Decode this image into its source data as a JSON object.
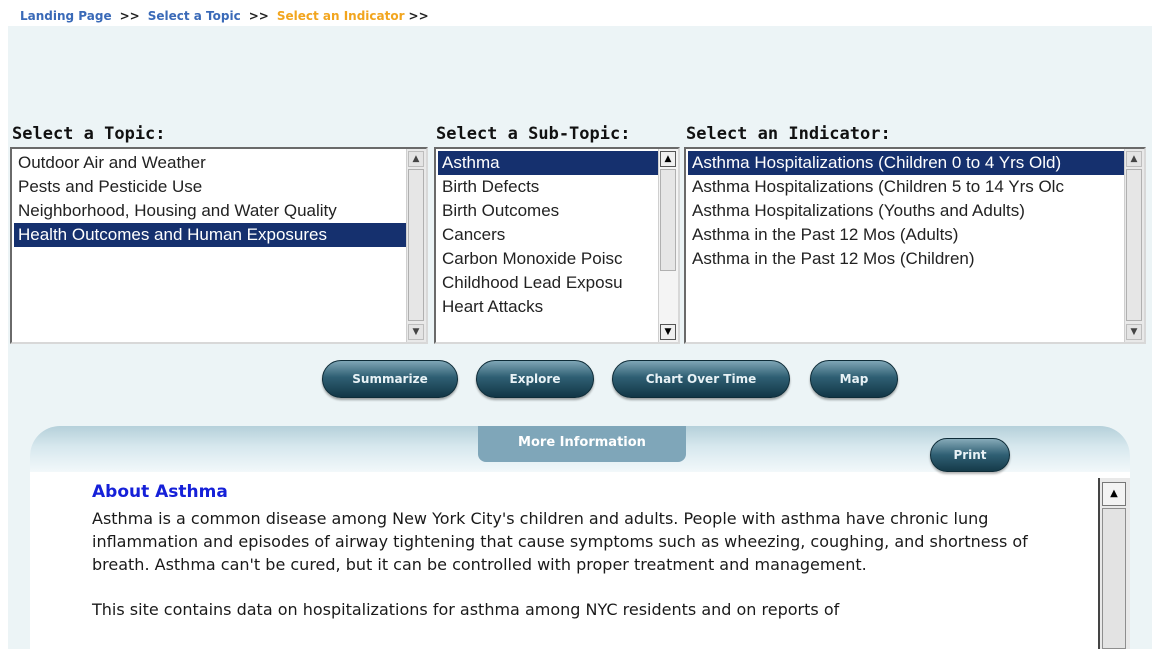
{
  "breadcrumb": {
    "items": [
      "Landing Page",
      "Select a Topic",
      "Select an Indicator"
    ],
    "separator": ">>"
  },
  "colors": {
    "breadcrumb_link": "#3a6ab8",
    "breadcrumb_current": "#f2a51e",
    "panel_background": "#ecf4f6",
    "selected_item": "#15306e",
    "button": "#2f5f73",
    "about_title": "#1520d8"
  },
  "topic": {
    "label": "Select a Topic:",
    "items": [
      "Outdoor Air and Weather",
      "Pests and Pesticide Use",
      "Neighborhood, Housing and Water Quality",
      "Health Outcomes and Human Exposures"
    ],
    "selected": "Health Outcomes and Human Exposures"
  },
  "subtopic": {
    "label": "Select a Sub-Topic:",
    "items": [
      "Asthma",
      "Birth Defects",
      "Birth Outcomes",
      "Cancers",
      "Carbon Monoxide Poisc",
      "Childhood Lead Exposu",
      "Heart Attacks"
    ],
    "selected": "Asthma"
  },
  "indicator": {
    "label": "Select an Indicator:",
    "items": [
      "Asthma Hospitalizations (Children 0 to 4 Yrs Old)",
      "Asthma Hospitalizations (Children 5 to 14 Yrs Olc",
      "Asthma Hospitalizations (Youths and Adults)",
      "Asthma in the Past 12 Mos (Adults)",
      "Asthma in the Past 12 Mos (Children)"
    ],
    "selected": "Asthma Hospitalizations (Children 0 to 4 Yrs Old)"
  },
  "actions": {
    "summarize": "Summarize",
    "explore": "Explore",
    "chart_over_time": "Chart Over Time",
    "map": "Map"
  },
  "more_info": {
    "tab_label": "More Information",
    "print_label": "Print",
    "about_title": "About Asthma",
    "paragraphs": [
      "Asthma is a common disease among New York City's children and adults. People with asthma have chronic lung inflammation and episodes of airway tightening that cause symptoms such as wheezing, coughing, and shortness of breath. Asthma can't be cured, but it can be controlled with proper treatment and management.",
      "This site contains data on hospitalizations for asthma among NYC residents and on reports of"
    ]
  },
  "icons": {
    "scroll_up": "scroll-up-arrow-icon",
    "scroll_down": "scroll-down-arrow-icon"
  }
}
